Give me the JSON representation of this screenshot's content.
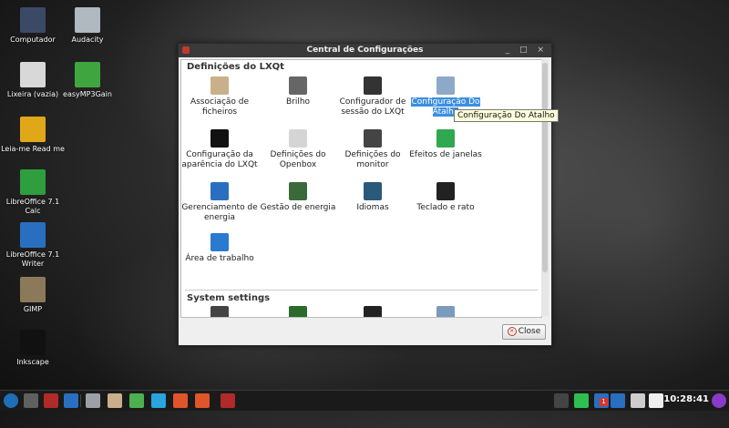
{
  "desktop": {
    "icons": [
      {
        "label": "Computador",
        "icon": "computer-icon",
        "color": "#3a4a66"
      },
      {
        "label": "Audacity",
        "icon": "audacity-icon",
        "color": "#b0b8c0"
      },
      {
        "label": "Lixeira (vazia)",
        "icon": "trash-icon",
        "color": "#d8d8d8"
      },
      {
        "label": "easyMP3Gain",
        "icon": "easymp3gain-icon",
        "color": "#3fa63f"
      },
      {
        "label": "Leia-me Read me",
        "icon": "info-icon",
        "color": "#e0a818"
      },
      {
        "label": "LibreOffice 7.1 Calc",
        "icon": "calc-icon",
        "color": "#2e9e3e"
      },
      {
        "label": "LibreOffice 7.1 Writer",
        "icon": "writer-icon",
        "color": "#2a6fbf"
      },
      {
        "label": "GIMP",
        "icon": "gimp-icon",
        "color": "#8b7a5a"
      },
      {
        "label": "Inkscape",
        "icon": "inkscape-icon",
        "color": "#111111"
      }
    ]
  },
  "window": {
    "title": "Central de Configurações",
    "controls": "_ □ ×",
    "sections": [
      {
        "title": "Definições do LXQt",
        "items": [
          {
            "label": "Associação de ficheiros",
            "icon": "file-association-icon",
            "color": "#c9b08a",
            "selected": false
          },
          {
            "label": "Brilho",
            "icon": "brightness-icon",
            "color": "#666666",
            "selected": false
          },
          {
            "label": "Configurador de sessão do LXQt",
            "icon": "session-gear-icon",
            "color": "#333333",
            "selected": false
          },
          {
            "label": "Configuração Do Atalho",
            "icon": "shortcut-icon",
            "color": "#8ea8c8",
            "selected": true
          },
          {
            "label": "Configuração da aparência do LXQt",
            "icon": "appearance-tuxedo-icon",
            "color": "#111111",
            "selected": false
          },
          {
            "label": "Definições do Openbox",
            "icon": "openbox-icon",
            "color": "#d5d5d5",
            "selected": false
          },
          {
            "label": "Definições do monitor",
            "icon": "monitor-icon",
            "color": "#444444",
            "selected": false
          },
          {
            "label": "Efeitos de janelas",
            "icon": "window-effects-icon",
            "color": "#2fa84f",
            "selected": false
          },
          {
            "label": "Gerenciamento de energia",
            "icon": "info-icon",
            "color": "#2a6fbf",
            "selected": false
          },
          {
            "label": "Gestão de energia",
            "icon": "battery-icon",
            "color": "#3a6a3a",
            "selected": false
          },
          {
            "label": "Idiomas",
            "icon": "globe-icon",
            "color": "#2a5a7a",
            "selected": false
          },
          {
            "label": "Teclado e rato",
            "icon": "keyboard-mouse-icon",
            "color": "#222222",
            "selected": false
          },
          {
            "label": "Área de trabalho",
            "icon": "desktop-icon",
            "color": "#2a7ad0",
            "selected": false
          }
        ]
      },
      {
        "title": "System settings",
        "items": [
          {
            "label": "",
            "icon": "tux-icon",
            "color": "#444444"
          },
          {
            "label": "",
            "icon": "terminal-icon",
            "color": "#2a6a2a"
          },
          {
            "label": "",
            "icon": "drive-icon",
            "color": "#222222"
          },
          {
            "label": "",
            "icon": "network-icon",
            "color": "#7a9ac0"
          }
        ]
      }
    ],
    "close_label": "Close",
    "tooltip": "Configuração Do Atalho"
  },
  "taskbar": {
    "clock": "10:28:41",
    "left_buttons": [
      {
        "icon": "start-menu-icon",
        "color": "#1e6fb8"
      },
      {
        "icon": "show-desktop-icon",
        "color": "#606060"
      },
      {
        "icon": "app-red-icon",
        "color": "#b02a2a"
      },
      {
        "icon": "toggle-icon",
        "color": "#2a6fbf"
      },
      {
        "icon": "file-manager-icon",
        "color": "#9aa0a6"
      },
      {
        "icon": "settings-icon",
        "color": "#c9b08a"
      },
      {
        "icon": "chrome-icon",
        "color": "#4caf50"
      },
      {
        "icon": "telegram-icon",
        "color": "#2aa3df"
      },
      {
        "icon": "brave-icon",
        "color": "#e0552a"
      },
      {
        "icon": "brave-icon",
        "color": "#e0552a"
      },
      {
        "icon": "app-red-icon",
        "color": "#b02a2a"
      }
    ],
    "tray": [
      {
        "icon": "network-disconnected-icon",
        "color": "#444444"
      },
      {
        "icon": "wifi-icon",
        "color": "#2fbf4f"
      },
      {
        "icon": "updates-icon",
        "color": "#2a6fbf",
        "badge": "1"
      },
      {
        "icon": "info-icon",
        "color": "#2a6fbf"
      },
      {
        "icon": "volume-icon",
        "color": "#cccccc"
      },
      {
        "icon": "clipboard-icon",
        "color": "#eeeeee"
      }
    ],
    "power_icon_color": "#8a3ac8"
  }
}
